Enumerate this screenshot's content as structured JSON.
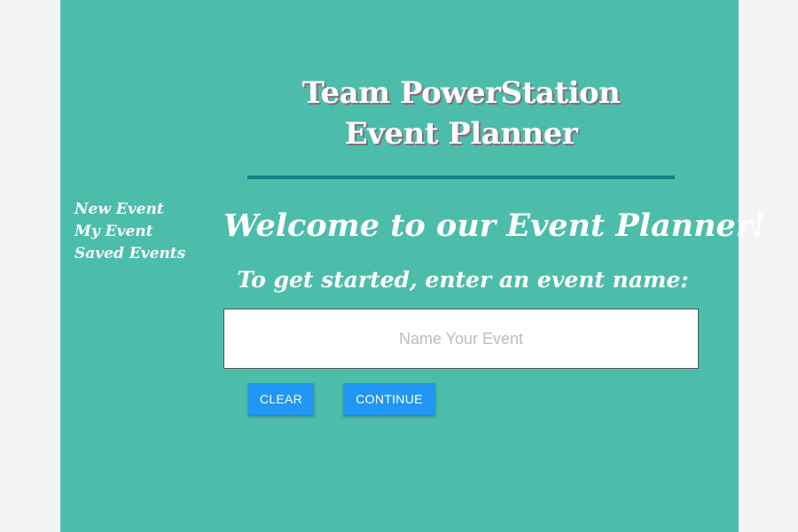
{
  "header": {
    "title_line1": "Team PowerStation",
    "title_line2": "Event Planner"
  },
  "sidebar": {
    "items": [
      {
        "label": "New Event"
      },
      {
        "label": "My Event"
      },
      {
        "label": "Saved Events"
      }
    ]
  },
  "main": {
    "welcome": "Welcome to our Event Planner!",
    "prompt": "To get started, enter an event name:",
    "event_input": {
      "value": "",
      "placeholder": "Name Your Event"
    },
    "buttons": {
      "clear_label": "CLEAR",
      "continue_label": "CONTINUE"
    }
  },
  "colors": {
    "page_background": "#4cbdaa",
    "outer_background": "#f4f4f4",
    "divider": "#0f8282",
    "button": "#2196f3",
    "text": "#ffffff"
  }
}
